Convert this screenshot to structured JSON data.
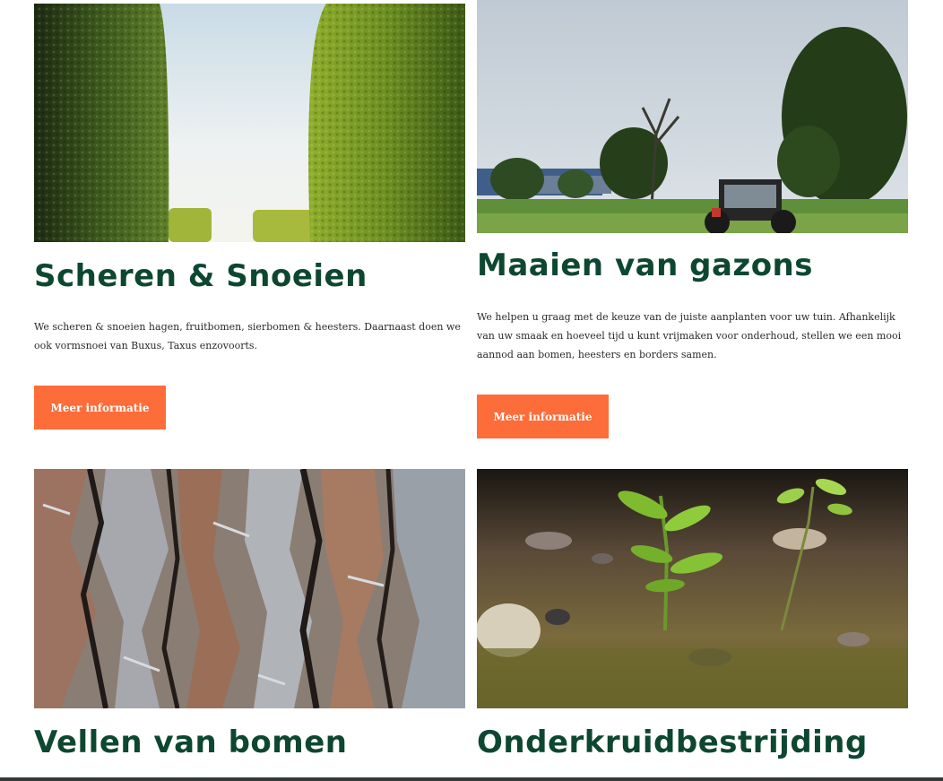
{
  "services": [
    {
      "image_alt": "hedges-photo",
      "title": "Scheren & Snoeien",
      "description": "We scheren & snoeien hagen, fruitbomen, sierbomen & heesters. Daarnaast doen we ook vormsnoei van Buxus, Taxus enzovoorts.",
      "button_label": "Meer informatie"
    },
    {
      "image_alt": "tractor-mowing-photo",
      "title": "Maaien van gazons",
      "description": "We helpen u graag met de keuze van de juiste aanplanten voor uw tuin. Afhankelijk van uw smaak en hoeveel tijd u kunt vrijmaken voor onderhoud, stellen we een mooi aannod aan bomen, heesters en borders samen.",
      "button_label": "Meer informatie"
    },
    {
      "image_alt": "tree-bark-photo",
      "title": "Vellen van bomen"
    },
    {
      "image_alt": "seedlings-photo",
      "title": "Onderkruidbestrijding"
    }
  ],
  "colors": {
    "title": "#0e4731",
    "button": "#fc6d3a",
    "text": "#2b2b2b"
  }
}
